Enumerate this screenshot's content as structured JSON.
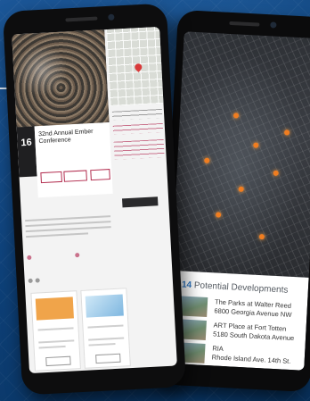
{
  "event": {
    "day": "16",
    "title": "32nd Annual Ember Conference"
  },
  "developments": {
    "count": "14",
    "header": "Potential Developments",
    "items": [
      {
        "name": "The Parks at Walter Reed",
        "address": "6800 Georgia Avenue NW"
      },
      {
        "name": "ART Place at Fort Totten",
        "address": "5180 South Dakota Avenue"
      },
      {
        "name": "RIA",
        "address": "Rhode Island Ave. 14th St."
      }
    ]
  },
  "colors": {
    "background": "#0e3f78",
    "event_accent": "#b22c4e",
    "developments_count": "#2f78c4",
    "map_markers": "#f07d20"
  }
}
